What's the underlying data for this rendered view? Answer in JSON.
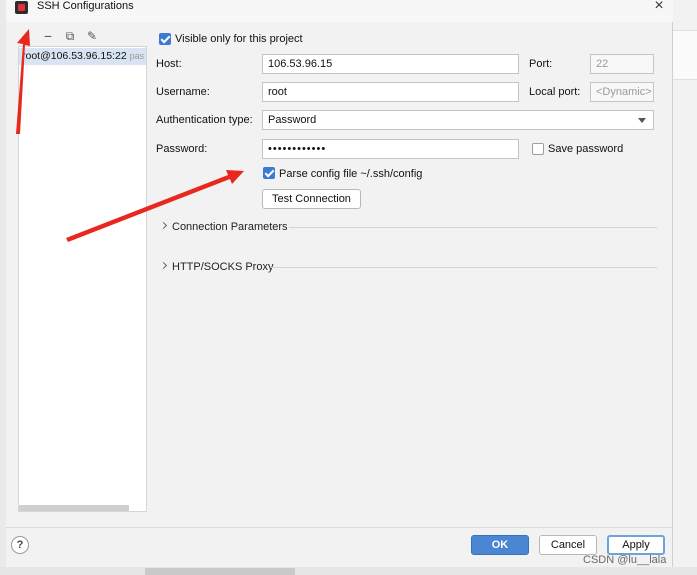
{
  "window": {
    "title": "SSH Configurations"
  },
  "toolbar": {
    "add": "+",
    "remove": "−",
    "copy": "⧉",
    "edit": "✎"
  },
  "sidebar": {
    "items": [
      {
        "label": "root@106.53.96.15:22",
        "hint": "pas"
      }
    ]
  },
  "form": {
    "visible_only_label": "Visible only for this project",
    "visible_only_checked": true,
    "host_label": "Host:",
    "host_value": "106.53.96.15",
    "port_label": "Port:",
    "port_value": "22",
    "username_label": "Username:",
    "username_value": "root",
    "local_port_label": "Local port:",
    "local_port_placeholder": "<Dynamic>",
    "auth_type_label": "Authentication type:",
    "auth_type_value": "Password",
    "password_label": "Password:",
    "password_value": "••••••••••••",
    "save_password_label": "Save password",
    "save_password_checked": false,
    "parse_config_label": "Parse config file ~/.ssh/config",
    "parse_config_checked": true,
    "test_connection_label": "Test Connection",
    "connection_params_label": "Connection Parameters",
    "http_proxy_label": "HTTP/SOCKS Proxy"
  },
  "footer": {
    "help": "?",
    "ok": "OK",
    "cancel": "Cancel",
    "apply": "Apply"
  },
  "watermark": "CSDN @lu__lala",
  "colors": {
    "accent": "#3d7bd1",
    "annotation_arrow": "#e8281e",
    "dialog_bg": "#f2f2f2"
  }
}
